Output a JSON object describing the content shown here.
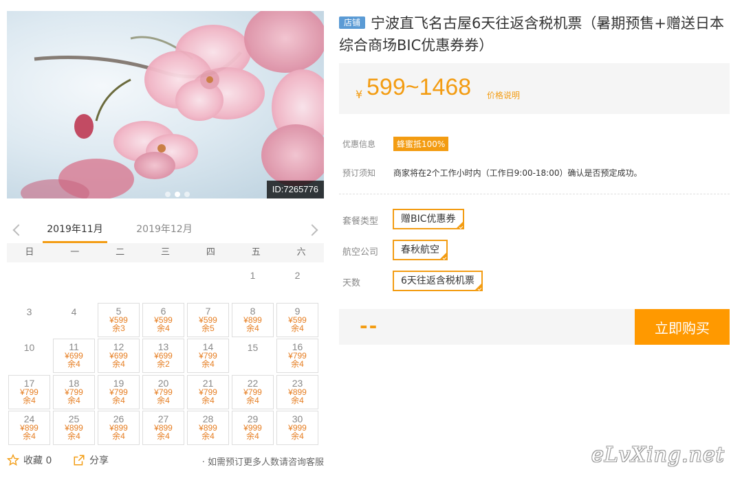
{
  "photo": {
    "id_label": "ID:7265776",
    "slide_count": 3,
    "active_slide": 1
  },
  "product": {
    "shop_badge": "店铺",
    "title": "宁波直飞名古屋6天往返含税机票（暑期预售+赠送日本综合商场BIC优惠券券）"
  },
  "price": {
    "currency": "¥",
    "range": "599~1468",
    "note": "价格说明"
  },
  "info": {
    "promo_label": "优惠信息",
    "promo_value": "蜂蜜抵100%",
    "notice_label": "预订须知",
    "notice_value": "商家将在2个工作小时内（工作日9:00-18:00）确认是否预定成功。"
  },
  "options": [
    {
      "label": "套餐类型",
      "value": "赠BIC优惠券"
    },
    {
      "label": "航空公司",
      "value": "春秋航空"
    },
    {
      "label": "天数",
      "value": "6天往返含税机票"
    }
  ],
  "buy": {
    "total": "--",
    "button": "立即购买"
  },
  "calendar": {
    "tabs": [
      "2019年11月",
      "2019年12月"
    ],
    "active_tab": 0,
    "weekdays": [
      "日",
      "一",
      "二",
      "三",
      "四",
      "五",
      "六"
    ],
    "cells": [
      {
        "row": 0,
        "col": 5,
        "day": "1"
      },
      {
        "row": 0,
        "col": 6,
        "day": "2"
      },
      {
        "row": 1,
        "col": 0,
        "day": "3"
      },
      {
        "row": 1,
        "col": 1,
        "day": "4"
      },
      {
        "row": 1,
        "col": 2,
        "day": "5",
        "price": "¥599",
        "remain": "余3"
      },
      {
        "row": 1,
        "col": 3,
        "day": "6",
        "price": "¥599",
        "remain": "余4"
      },
      {
        "row": 1,
        "col": 4,
        "day": "7",
        "price": "¥599",
        "remain": "余5"
      },
      {
        "row": 1,
        "col": 5,
        "day": "8",
        "price": "¥899",
        "remain": "余4"
      },
      {
        "row": 1,
        "col": 6,
        "day": "9",
        "price": "¥599",
        "remain": "余4"
      },
      {
        "row": 2,
        "col": 0,
        "day": "10"
      },
      {
        "row": 2,
        "col": 1,
        "day": "11",
        "price": "¥699",
        "remain": "余4"
      },
      {
        "row": 2,
        "col": 2,
        "day": "12",
        "price": "¥699",
        "remain": "余4"
      },
      {
        "row": 2,
        "col": 3,
        "day": "13",
        "price": "¥699",
        "remain": "余2"
      },
      {
        "row": 2,
        "col": 4,
        "day": "14",
        "price": "¥799",
        "remain": "余4"
      },
      {
        "row": 2,
        "col": 5,
        "day": "15"
      },
      {
        "row": 2,
        "col": 6,
        "day": "16",
        "price": "¥799",
        "remain": "余4"
      },
      {
        "row": 3,
        "col": 0,
        "day": "17",
        "price": "¥799",
        "remain": "余4"
      },
      {
        "row": 3,
        "col": 1,
        "day": "18",
        "price": "¥799",
        "remain": "余4"
      },
      {
        "row": 3,
        "col": 2,
        "day": "19",
        "price": "¥799",
        "remain": "余4"
      },
      {
        "row": 3,
        "col": 3,
        "day": "20",
        "price": "¥799",
        "remain": "余4"
      },
      {
        "row": 3,
        "col": 4,
        "day": "21",
        "price": "¥799",
        "remain": "余4"
      },
      {
        "row": 3,
        "col": 5,
        "day": "22",
        "price": "¥799",
        "remain": "余4"
      },
      {
        "row": 3,
        "col": 6,
        "day": "23",
        "price": "¥899",
        "remain": "余4"
      },
      {
        "row": 4,
        "col": 0,
        "day": "24",
        "price": "¥899",
        "remain": "余4"
      },
      {
        "row": 4,
        "col": 1,
        "day": "25",
        "price": "¥899",
        "remain": "余4"
      },
      {
        "row": 4,
        "col": 2,
        "day": "26",
        "price": "¥899",
        "remain": "余4"
      },
      {
        "row": 4,
        "col": 3,
        "day": "27",
        "price": "¥899",
        "remain": "余4"
      },
      {
        "row": 4,
        "col": 4,
        "day": "28",
        "price": "¥899",
        "remain": "余4"
      },
      {
        "row": 4,
        "col": 5,
        "day": "29",
        "price": "¥999",
        "remain": "余4"
      },
      {
        "row": 4,
        "col": 6,
        "day": "30",
        "price": "¥999",
        "remain": "余4"
      }
    ]
  },
  "footer": {
    "favorite": "收藏 0",
    "share": "分享",
    "tip": "· 如需预订更多人数请咨询客服"
  },
  "watermark": "eLvXing.net",
  "colors": {
    "accent": "#f39c12",
    "buy_button": "#ff9900",
    "shop_badge": "#5b9bd5"
  },
  "icons": {
    "favorite": "star-outline-icon",
    "share": "share-arrow-icon",
    "prev": "chevron-left-icon",
    "next": "chevron-right-icon"
  }
}
